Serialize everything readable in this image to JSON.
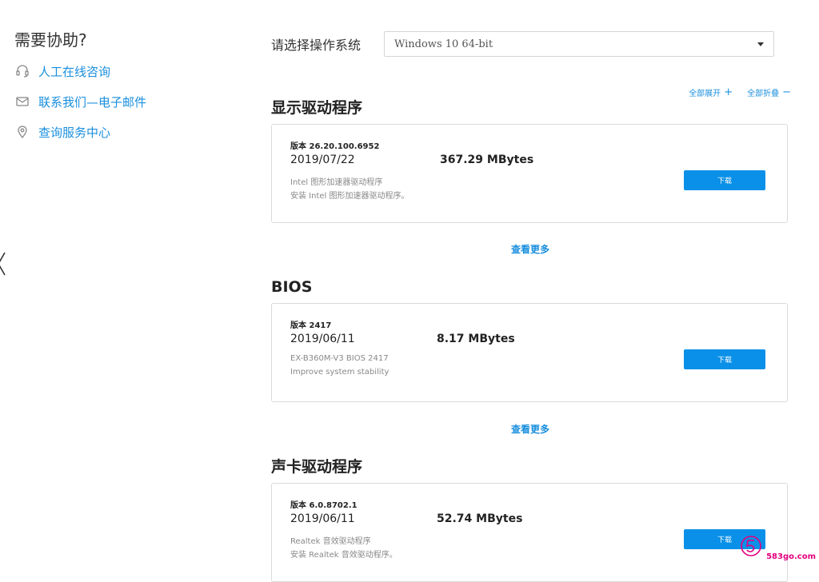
{
  "sidebar": {
    "title": "需要协助?",
    "items": [
      {
        "label": "人工在线咨询",
        "icon": "headset-icon"
      },
      {
        "label": "联系我们—电子邮件",
        "icon": "mail-icon"
      },
      {
        "label": "查询服务中心",
        "icon": "location-pin-icon"
      }
    ]
  },
  "os": {
    "label": "请选择操作系统",
    "selected": "Windows 10 64-bit"
  },
  "controls": {
    "expand_all": "全部展开",
    "collapse_all": "全部折叠"
  },
  "sections": [
    {
      "title": "显示驱动程序",
      "version": "版本 26.20.100.6952",
      "date": "2019/07/22",
      "size": "367.29 MBytes",
      "desc1": "Intel 图形加速器驱动程序",
      "desc2": "安装 Intel 图形加速器驱动程序。",
      "download": "下载",
      "more": "查看更多"
    },
    {
      "title": "BIOS",
      "version": "版本 2417",
      "date": "2019/06/11",
      "size": "8.17 MBytes",
      "desc1": "EX-B360M-V3 BIOS 2417",
      "desc2": "Improve system stability",
      "download": "下载",
      "more": "查看更多"
    },
    {
      "title": "声卡驱动程序",
      "version": "版本 6.0.8702.1",
      "date": "2019/06/11",
      "size": "52.74 MBytes",
      "desc1": "Realtek 音效驱动程序",
      "desc2": "安装 Realtek 音效驱动程序。",
      "download": "下载"
    }
  ],
  "watermark": {
    "text": "583go.com"
  },
  "colors": {
    "accent": "#1a8fde",
    "button": "#0a90e8",
    "watermark": "#e4007f"
  }
}
